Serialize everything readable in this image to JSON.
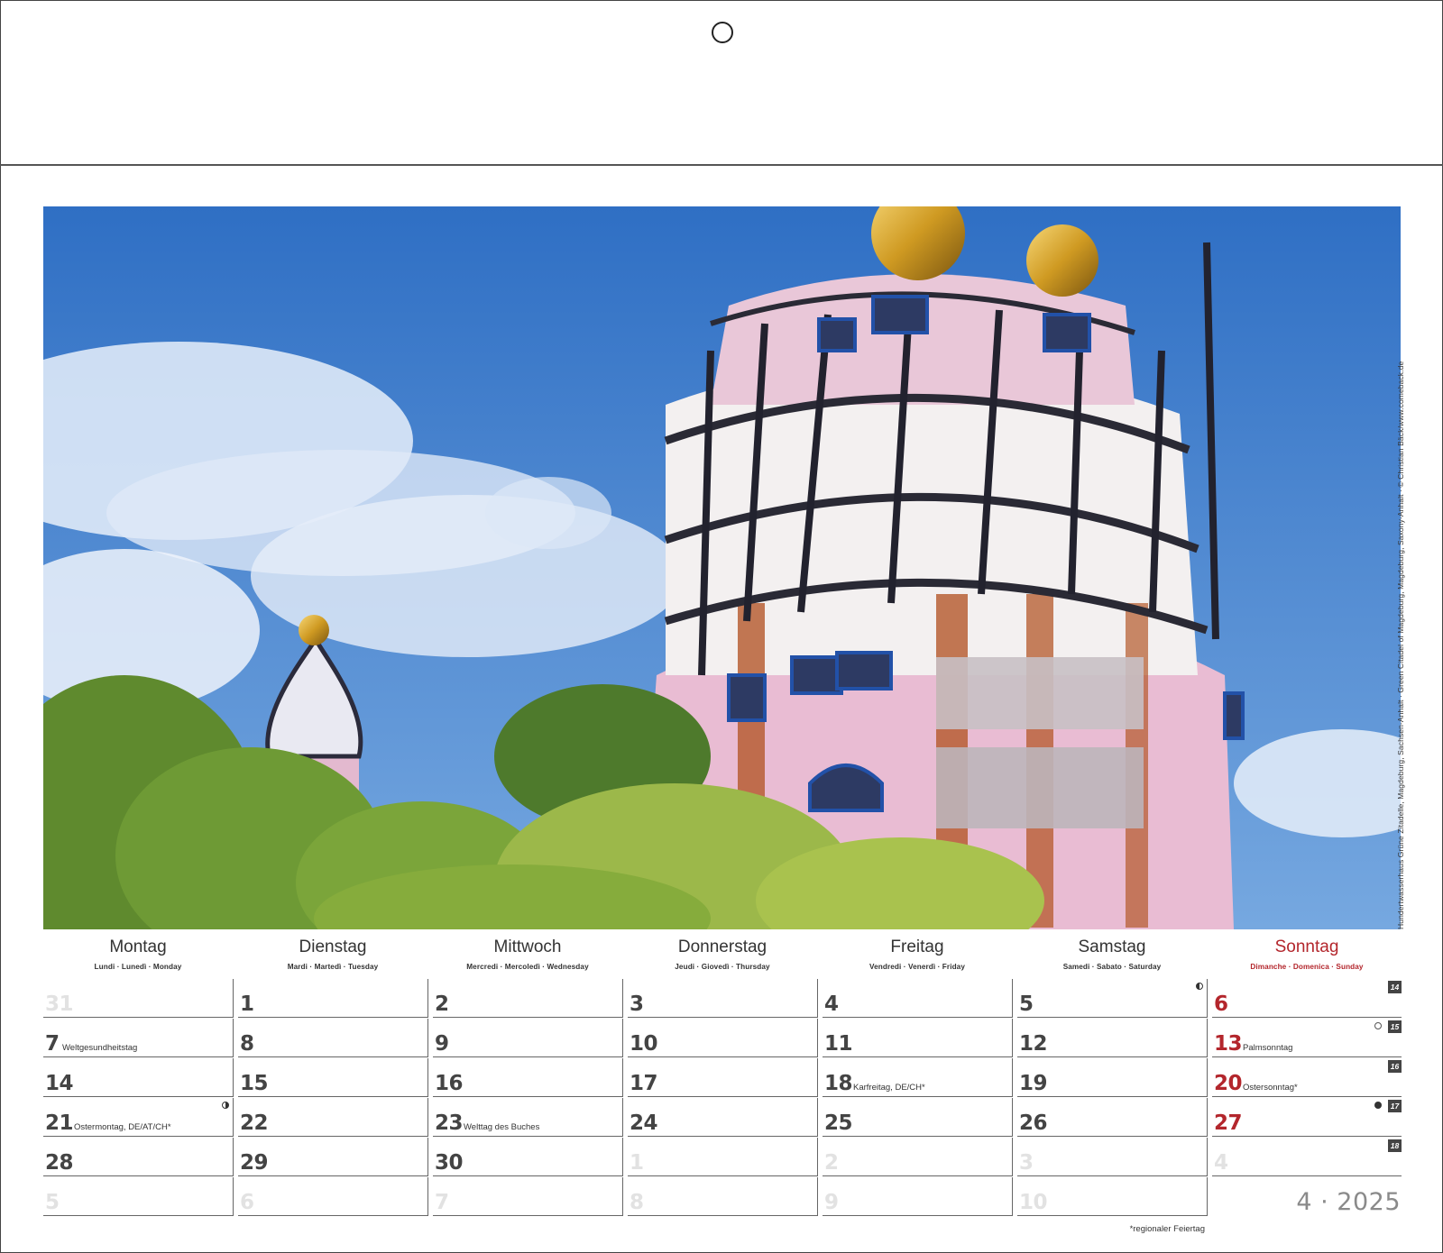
{
  "photo_credit": "Hundertwasserhaus Grüne Zitadelle, Magdeburg, Sachsen-Anhalt · Green Citadel of Magdeburg, Magdeburg, Saxony-Anhalt · © Christian Bäck/www.comeback.de",
  "weekdays": [
    {
      "name": "Montag",
      "sub": "Lundi · Lunedì · Monday"
    },
    {
      "name": "Dienstag",
      "sub": "Mardi · Martedì · Tuesday"
    },
    {
      "name": "Mittwoch",
      "sub": "Mercredi · Mercoledì · Wednesday"
    },
    {
      "name": "Donnerstag",
      "sub": "Jeudi · Giovedì · Thursday"
    },
    {
      "name": "Freitag",
      "sub": "Vendredi · Venerdì · Friday"
    },
    {
      "name": "Samstag",
      "sub": "Samedi · Sabato · Saturday"
    },
    {
      "name": "Sonntag",
      "sub": "Dimanche · Domenica · Sunday"
    }
  ],
  "weeks": [
    {
      "week": "14",
      "days": [
        {
          "num": "31",
          "faded": true
        },
        {
          "num": "1"
        },
        {
          "num": "2"
        },
        {
          "num": "3"
        },
        {
          "num": "4"
        },
        {
          "num": "5",
          "moon": "half"
        },
        {
          "num": "6",
          "red": true
        }
      ]
    },
    {
      "week": "15",
      "days": [
        {
          "num": "7",
          "holiday": "Weltgesundheitstag"
        },
        {
          "num": "8"
        },
        {
          "num": "9"
        },
        {
          "num": "10"
        },
        {
          "num": "11"
        },
        {
          "num": "12"
        },
        {
          "num": "13",
          "red": true,
          "holiday": "Palmsonntag",
          "moon": "full"
        }
      ]
    },
    {
      "week": "16",
      "days": [
        {
          "num": "14"
        },
        {
          "num": "15"
        },
        {
          "num": "16"
        },
        {
          "num": "17"
        },
        {
          "num": "18",
          "holiday": "Karfreitag, DE/CH*"
        },
        {
          "num": "19"
        },
        {
          "num": "20",
          "red": true,
          "holiday": "Ostersonntag*"
        }
      ]
    },
    {
      "week": "17",
      "days": [
        {
          "num": "21",
          "holiday": "Ostermontag, DE/AT/CH*",
          "moon": "half2"
        },
        {
          "num": "22"
        },
        {
          "num": "23",
          "holiday": "Welttag des Buches"
        },
        {
          "num": "24"
        },
        {
          "num": "25"
        },
        {
          "num": "26"
        },
        {
          "num": "27",
          "red": true,
          "moon": "new"
        }
      ]
    },
    {
      "week": "18",
      "days": [
        {
          "num": "28"
        },
        {
          "num": "29"
        },
        {
          "num": "30"
        },
        {
          "num": "1",
          "faded": true
        },
        {
          "num": "2",
          "faded": true
        },
        {
          "num": "3",
          "faded": true
        },
        {
          "num": "4",
          "faded": true
        }
      ]
    },
    {
      "week": "",
      "days": [
        {
          "num": "5",
          "faded": true
        },
        {
          "num": "6",
          "faded": true
        },
        {
          "num": "7",
          "faded": true
        },
        {
          "num": "8",
          "faded": true
        },
        {
          "num": "9",
          "faded": true
        },
        {
          "num": "10",
          "faded": true
        }
      ]
    }
  ],
  "month_year": "4 · 2025",
  "footnote": "*regionaler Feiertag",
  "colors": {
    "sunday": "#b3262c",
    "text": "#333333",
    "faded": "#e2e2e2",
    "sky": "#3f7fd0"
  }
}
